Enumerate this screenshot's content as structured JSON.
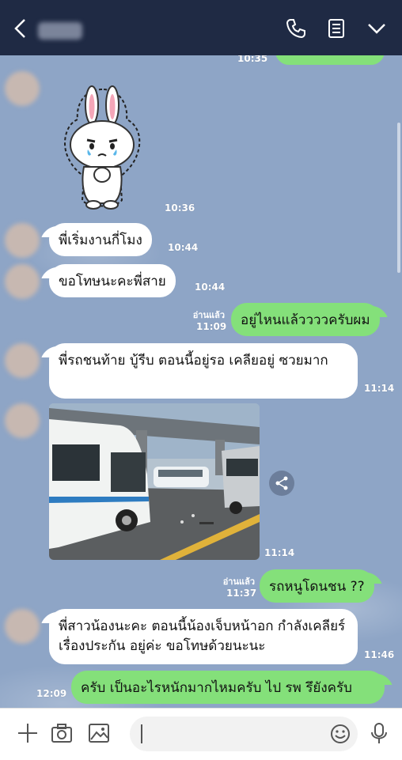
{
  "header": {
    "back_icon": "chevron-left-icon",
    "contact_name": "",
    "icons": [
      "phone-icon",
      "notes-icon",
      "chevron-down-icon"
    ]
  },
  "messages": [
    {
      "side": "right",
      "time": "10:35",
      "text": ""
    },
    {
      "side": "left",
      "type": "sticker",
      "sticker": "crying-bunny-sticker",
      "time": "10:36"
    },
    {
      "side": "left",
      "text": "พี่เริ่มงานกี่โมง",
      "time": "10:44"
    },
    {
      "side": "left",
      "text": "ขอโทษนะคะพี่สาย",
      "time": "10:44"
    },
    {
      "side": "right",
      "read": "อ่านแล้ว",
      "text": "อยู่ไหนแล้ววววครับผม",
      "time": "11:09"
    },
    {
      "side": "left",
      "text": "พี่รถชนท้าย บู้รีบ ตอนนี้อยู่รอ เคลียอยู่  ซวยมาก",
      "time": "11:14"
    },
    {
      "side": "left",
      "type": "photo",
      "photo": "car-accident-photo",
      "time": "11:14"
    },
    {
      "side": "right",
      "read": "อ่านแล้ว",
      "text": "รถหนูโดนชน ??",
      "time": "11:37"
    },
    {
      "side": "left",
      "text": "พี่สาวน้องนะคะ ตอนนี้น้องเจ็บหน้าอก กำลังเคลียร์เรื่องประกัน อยู่ค่ะ ขอโทษด้วยนะนะ",
      "time": "11:46"
    },
    {
      "side": "right",
      "text": "ครับ เป็นอะไรหนักมากไหมครับ ไป รพ รึยังครับ",
      "time": "12:09"
    }
  ],
  "composer": {
    "placeholder": "",
    "icons": [
      "plus-icon",
      "camera-icon",
      "image-icon",
      "emoji-icon",
      "microphone-icon"
    ]
  }
}
